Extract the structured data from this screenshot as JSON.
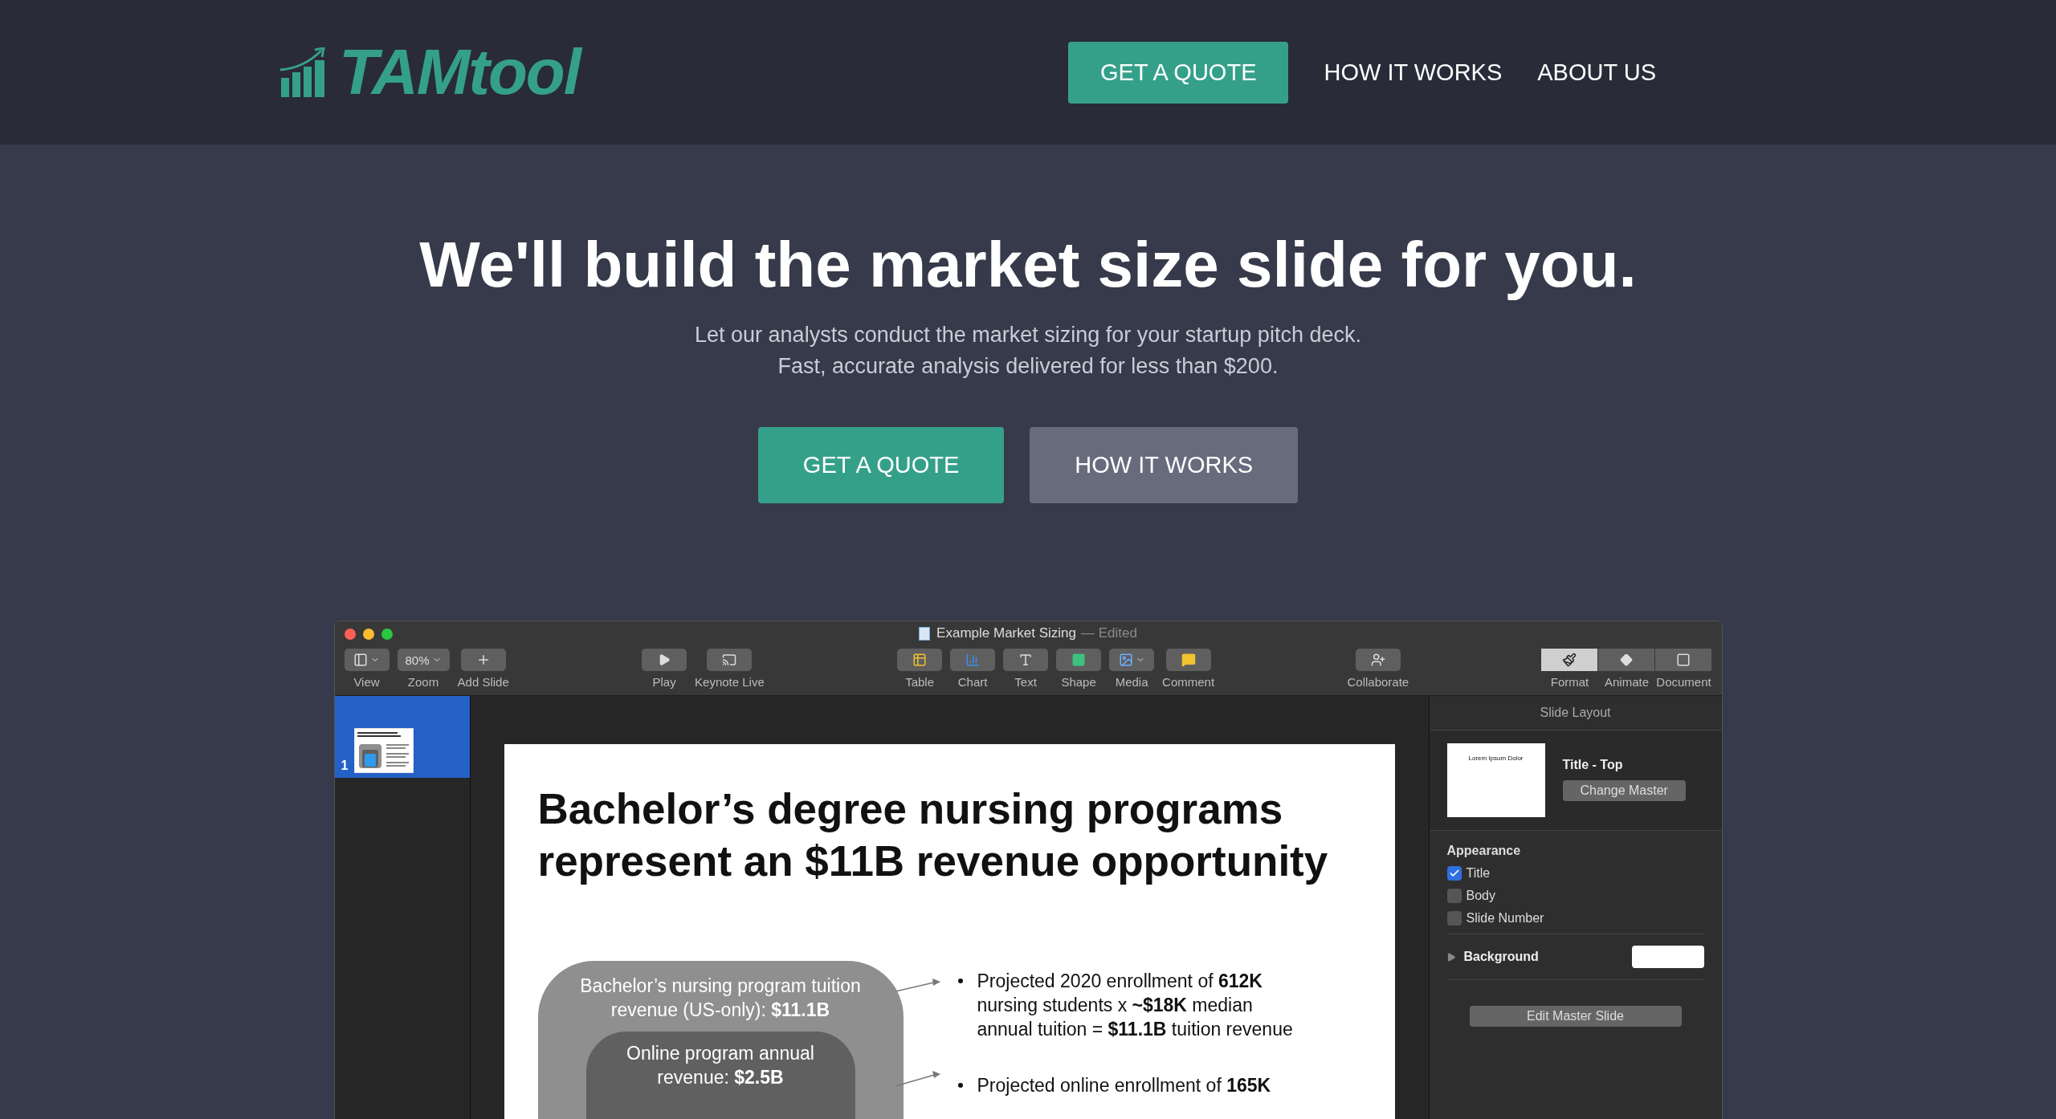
{
  "header": {
    "logo": "TAMtool",
    "nav": [
      {
        "kind": "button",
        "label": "GET A QUOTE"
      },
      {
        "kind": "link",
        "label": "HOW IT WORKS"
      },
      {
        "kind": "link",
        "label": "ABOUT US"
      }
    ]
  },
  "hero": {
    "title": "We'll build the market size slide for you.",
    "subtitle_lines": [
      "Let our analysts conduct the market sizing for your startup pitch deck.",
      "Fast, accurate analysis delivered for less than $200."
    ],
    "buttons": [
      {
        "kind": "primary",
        "label": "GET A QUOTE"
      },
      {
        "kind": "secondary",
        "label": "HOW IT WORKS"
      }
    ]
  },
  "app_window": {
    "title": "Example Market Sizing",
    "status": "— Edited",
    "toolbar_groups": [
      [
        {
          "label": "View",
          "kind": "dropdown"
        },
        {
          "label": "Zoom",
          "kind": "value",
          "value": "80%"
        },
        {
          "label": "Add Slide",
          "kind": "plain"
        }
      ],
      [
        {
          "label": "Play",
          "kind": "plain"
        },
        {
          "label": "Keynote Live",
          "kind": "plain"
        }
      ],
      [
        {
          "label": "Table",
          "kind": "plain"
        },
        {
          "label": "Chart",
          "kind": "plain"
        },
        {
          "label": "Text",
          "kind": "plain"
        },
        {
          "label": "Shape",
          "kind": "plain"
        },
        {
          "label": "Media",
          "kind": "dropdown"
        },
        {
          "label": "Comment",
          "kind": "plain"
        }
      ],
      [
        {
          "label": "Collaborate",
          "kind": "plain"
        }
      ],
      [
        {
          "label": "Format",
          "kind": "segment",
          "selected": true
        },
        {
          "label": "Animate",
          "kind": "segment",
          "selected": false
        },
        {
          "label": "Document",
          "kind": "segment",
          "selected": false
        }
      ]
    ],
    "slides": [
      {
        "number": "1",
        "selected": true
      }
    ],
    "slide": {
      "title_lines": [
        "Bachelor’s degree nursing programs",
        "represent an $11B revenue opportunity"
      ],
      "outer_box": "Bachelor’s nursing program tuition revenue (US-only): **$11.1B**",
      "inner_box": "Online program annual revenue: **$2.5B**",
      "bullets": [
        "Projected 2020 enrollment of **612K** nursing students x **~$18K** median annual tuition = **$11.1B** tuition revenue",
        "Projected online enrollment of **165K**"
      ]
    },
    "inspector": {
      "heading": "Slide Layout",
      "master_preview": "Lorem Ipsum Dolor",
      "layout_name": "Title - Top",
      "change_button": "Change Master",
      "appearance_heading": "Appearance",
      "checkboxes": [
        {
          "label": "Title",
          "checked": true
        },
        {
          "label": "Body",
          "checked": false
        },
        {
          "label": "Slide Number",
          "checked": false
        }
      ],
      "background": {
        "label": "Background",
        "expanded": false
      },
      "edit_button": "Edit Master Slide"
    }
  }
}
